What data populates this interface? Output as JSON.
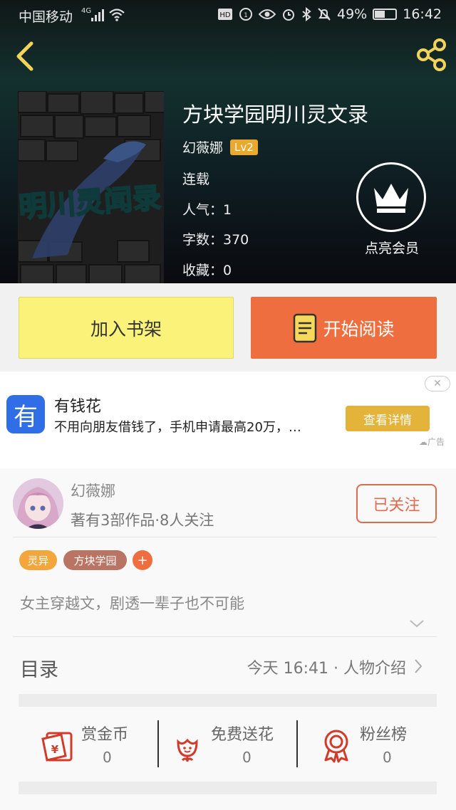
{
  "status_bar": {
    "carrier": "中国移动",
    "network": "4G",
    "battery": "49%",
    "battery_level": 0.49,
    "time": "16:42"
  },
  "header": {
    "back_icon": "back-arrow-icon",
    "share_icon": "share-icon"
  },
  "book": {
    "title": "方块学园明川灵文录",
    "author": "幻薇娜",
    "level": "Lv2",
    "status": "连载",
    "popularity": "人气：1",
    "word_count": "字数：370",
    "favorites": "收藏：0",
    "cover_text": "明川灵闻录"
  },
  "vip": {
    "label": "点亮会员",
    "icon": "crown-icon"
  },
  "actions": {
    "add_shelf": "加入书架",
    "start_read": "开始阅读"
  },
  "ad": {
    "logo_char": "有",
    "title": "有钱花",
    "description": "不用向朋友借钱了，手机申请最高20万，…",
    "button": "查看详情",
    "tag": "广告"
  },
  "author_card": {
    "name": "幻薇娜",
    "stats": "著有3部作品·8人关注",
    "follow": "已关注"
  },
  "tags": [
    {
      "label": "灵异",
      "color": "#f2a63b"
    },
    {
      "label": "方块学园",
      "color": "#b97463"
    },
    {
      "label": "+",
      "color": "#ee6e3f"
    }
  ],
  "intro": "女主穿越文，剧透一辈子也不可能",
  "toc": {
    "label": "目录",
    "latest": "今天 16:41 · 人物介绍"
  },
  "stats": [
    {
      "label": "赏金币",
      "value": "0",
      "icon": "red-envelope-icon"
    },
    {
      "label": "免费送花",
      "value": "0",
      "icon": "flower-icon"
    },
    {
      "label": "粉丝榜",
      "value": "0",
      "icon": "medal-icon"
    }
  ],
  "colors": {
    "accent_orange": "#ee6e3f",
    "shelf_yellow": "#fbf27a",
    "ad_button": "#e4b43a",
    "follow_red": "#e06a4e"
  }
}
